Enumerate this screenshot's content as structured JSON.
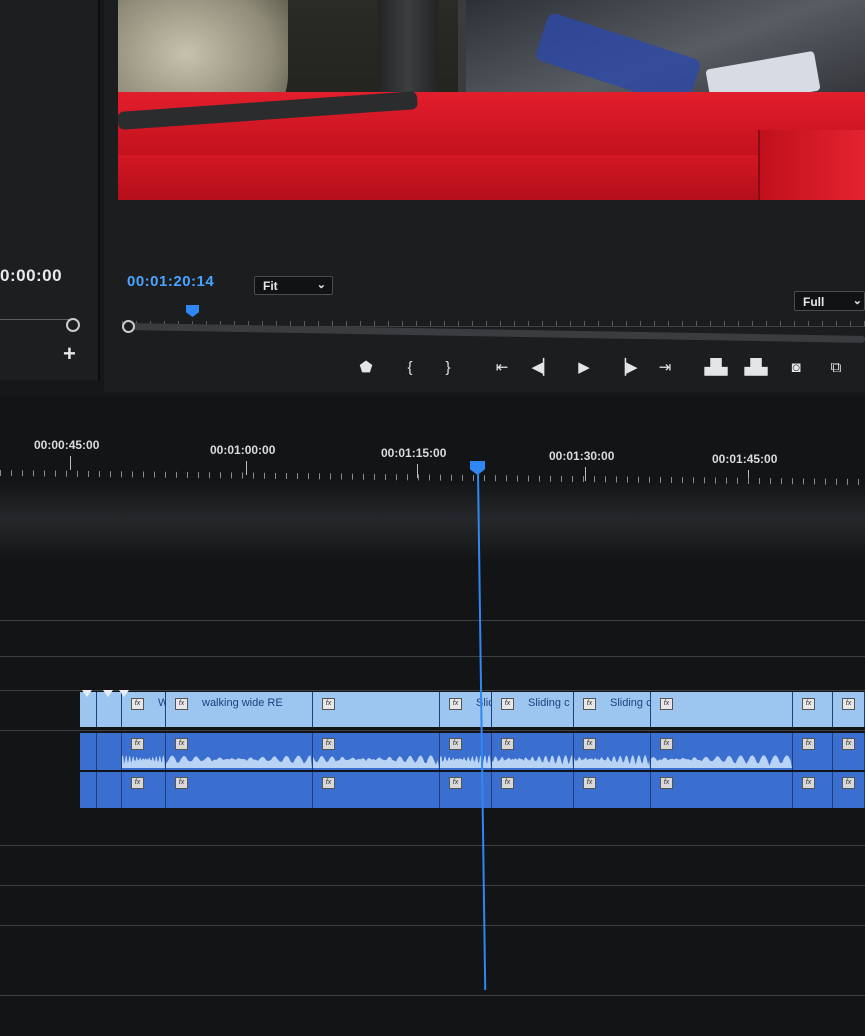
{
  "source_monitor": {
    "timecode": "0:00:00",
    "add_label": "+"
  },
  "program_monitor": {
    "timecode": "00:01:20:14",
    "zoom_select": "Fit",
    "resolution_select": "Full",
    "transport": [
      {
        "name": "add-marker-button",
        "glyph": "⬟"
      },
      {
        "name": "mark-in-button",
        "glyph": "{"
      },
      {
        "name": "mark-out-button",
        "glyph": "}"
      },
      {
        "name": "go-to-in-button",
        "glyph": "⇤"
      },
      {
        "name": "step-back-button",
        "glyph": "◀▏"
      },
      {
        "name": "play-button",
        "glyph": "▶"
      },
      {
        "name": "step-forward-button",
        "glyph": "▕▶"
      },
      {
        "name": "go-to-out-button",
        "glyph": "⇥"
      },
      {
        "name": "lift-button",
        "glyph": "▟▙"
      },
      {
        "name": "extract-button",
        "glyph": "▟▙"
      },
      {
        "name": "export-frame-button",
        "glyph": "◙"
      },
      {
        "name": "compare-view-button",
        "glyph": "⧉"
      }
    ]
  },
  "timeline": {
    "ruler_labels": [
      "00:00:45:00",
      "00:01:00:00",
      "00:01:15:00",
      "00:01:30:00",
      "00:01:45:00"
    ],
    "fx_label": "fx",
    "video_clips": [
      "",
      "",
      "Walking mid RED CA",
      "walking wide RE",
      "",
      "Sliding c",
      "Sliding c",
      "Sliding car CU [V]",
      "",
      ""
    ]
  },
  "colors": {
    "accent": "#2f86f5",
    "video_clip": "#9cc6ef",
    "audio_clip": "#3a6fcf",
    "timecode": "#4aa3ff"
  }
}
